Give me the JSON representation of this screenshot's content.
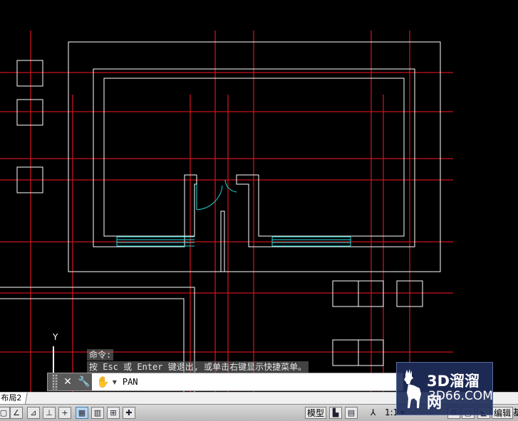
{
  "command_history": [
    "命令:",
    "按 Esc 或 Enter 键退出, 或单击右键显示快捷菜单。"
  ],
  "command_line": {
    "current_command": "PAN",
    "close_icon": "close-icon",
    "customize_icon": "wrench-icon",
    "recent_icon": "hand-pan-icon"
  },
  "layout_tabs": [
    {
      "label": "布局2"
    }
  ],
  "status_bar": {
    "model_label": "模型",
    "scale_label": "1:1",
    "edit_label": "编辑",
    "more_label": "基"
  },
  "ucs": {
    "y_label": "Y"
  },
  "watermark": {
    "title": "3D溜溜网",
    "subtitle": "3D66.COM"
  },
  "colors": {
    "background": "#000000",
    "construction_line": "#c8141e",
    "wall_line": "#ffffff",
    "door_window": "#23d7d7"
  }
}
